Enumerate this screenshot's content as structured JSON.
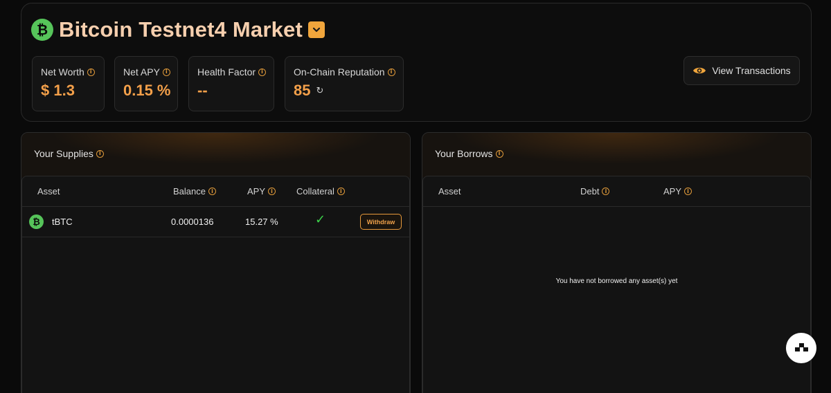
{
  "header": {
    "logo_glyph": "₿",
    "title": "Bitcoin Testnet4 Market",
    "accent_color": "#f0a53c",
    "title_color": "#f6cfae"
  },
  "stats": [
    {
      "label": "Net Worth",
      "value": "$ 1.3"
    },
    {
      "label": "Net APY",
      "value": "0.15 %"
    },
    {
      "label": "Health Factor",
      "value": "--"
    },
    {
      "label": "On-Chain Reputation",
      "value": "85"
    }
  ],
  "actions": {
    "view_transactions": "View Transactions"
  },
  "supplies": {
    "title": "Your Supplies",
    "columns": [
      "Asset",
      "Balance",
      "APY",
      "Collateral"
    ],
    "rows": [
      {
        "asset": "tBTC",
        "asset_glyph": "₿",
        "balance": "0.0000136",
        "apy": "15.27 %",
        "collateral": "✓",
        "action": "Withdraw"
      }
    ]
  },
  "borrows": {
    "title": "Your Borrows",
    "columns": [
      "Asset",
      "Debt",
      "APY"
    ],
    "empty_message": "You have not borrowed any asset(s) yet"
  },
  "info_glyph": "i",
  "refresh_glyph": "↻"
}
